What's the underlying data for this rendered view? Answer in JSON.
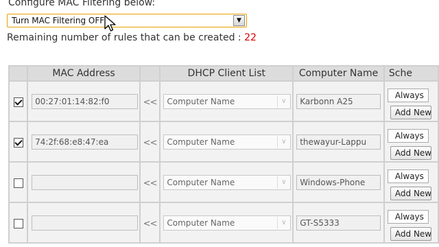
{
  "heading": "Configure MAC Filtering below:",
  "filter": {
    "selected": "Turn MAC Filtering OFF",
    "arrow_icon": "chevron-down-icon"
  },
  "remaining": {
    "label": "Remaining number of rules that can be created : ",
    "count": "22"
  },
  "table": {
    "headers": {
      "mac": "MAC Address",
      "dhcp": "DHCP Client List",
      "computer": "Computer Name",
      "schedule": "Sche"
    },
    "copy_label": "<<",
    "rows": [
      {
        "checked": true,
        "mac": "00:27:01:14:82:f0",
        "dhcp": "Computer Name",
        "computer": "Karbonn A25",
        "schedule": "Always",
        "add": "Add New"
      },
      {
        "checked": true,
        "mac": "74:2f:68:e8:47:ea",
        "dhcp": "Computer Name",
        "computer": "thewayur-Lappu",
        "schedule": "Always",
        "add": "Add New"
      },
      {
        "checked": false,
        "mac": "",
        "dhcp": "Computer Name",
        "computer": "Windows-Phone",
        "schedule": "Always",
        "add": "Add New"
      },
      {
        "checked": false,
        "mac": "",
        "dhcp": "Computer Name",
        "computer": "GT-S5333",
        "schedule": "Always",
        "add": "Add New"
      }
    ]
  }
}
